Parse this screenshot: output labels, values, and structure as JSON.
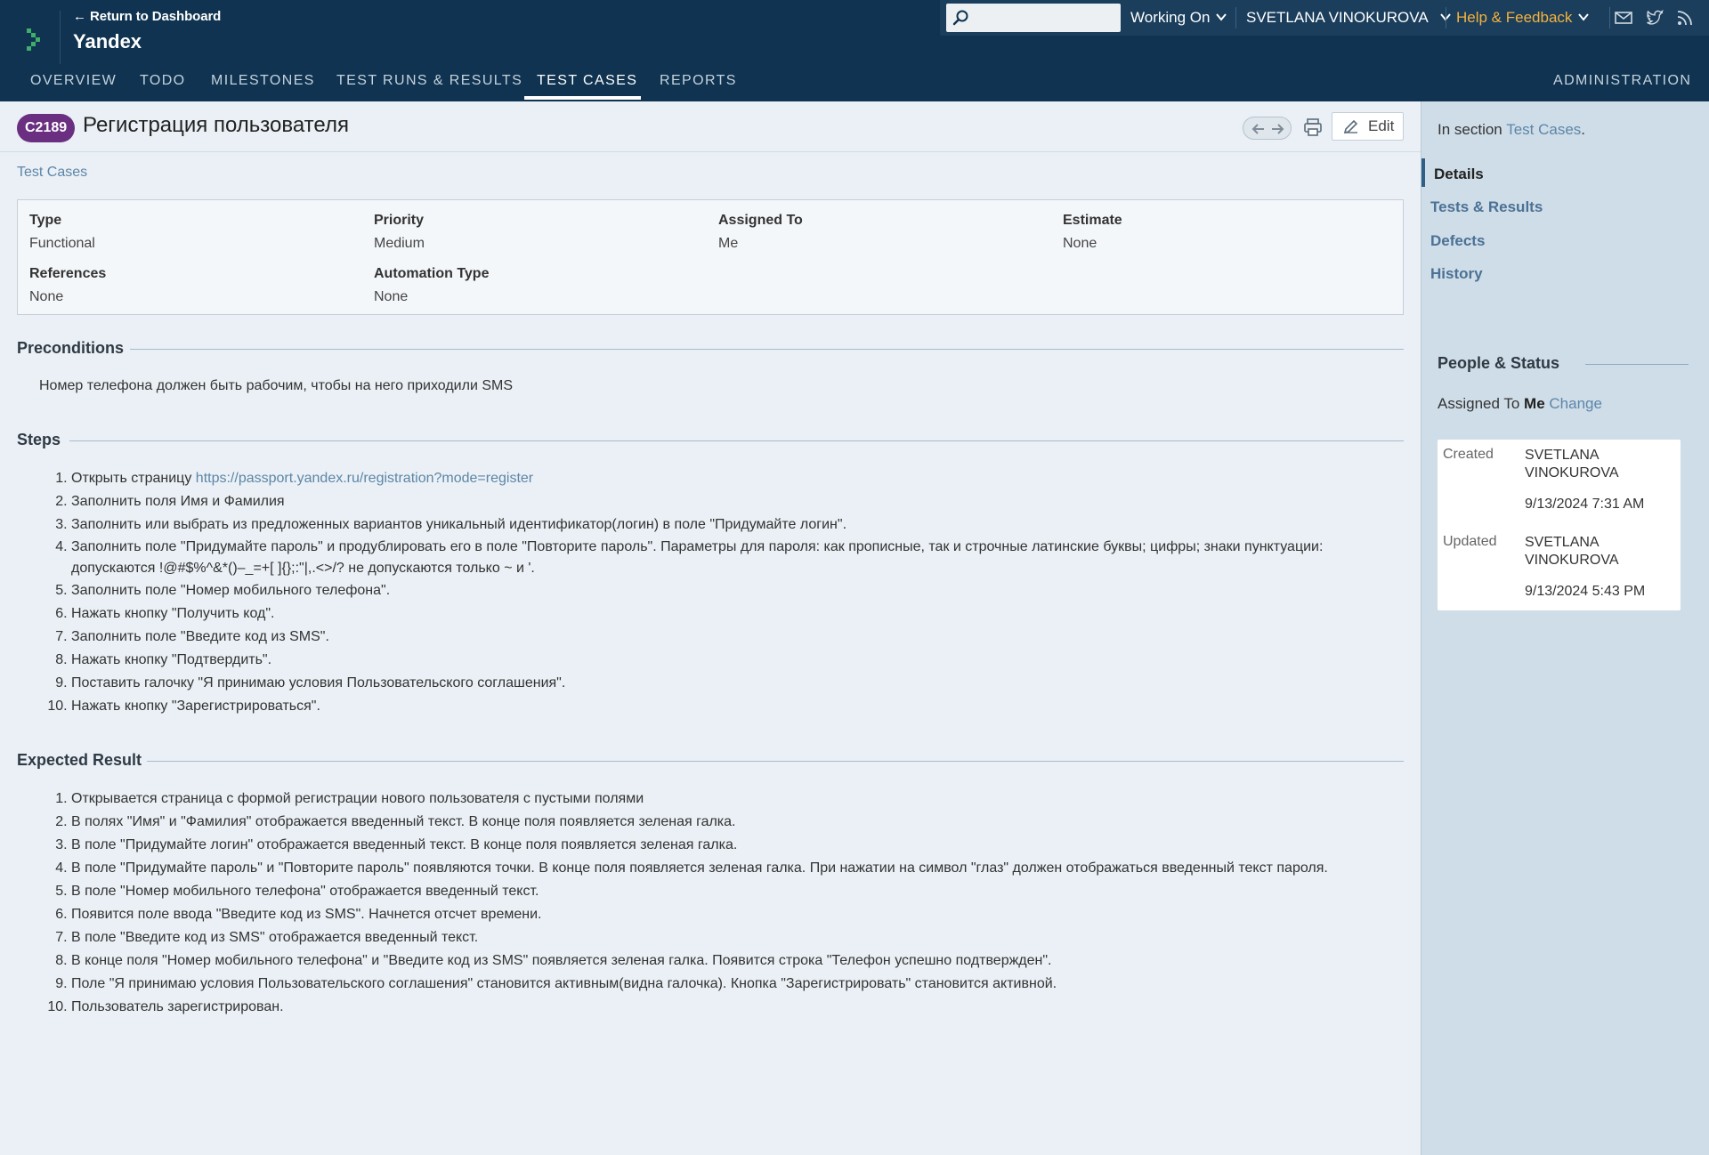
{
  "header": {
    "back_link": "← Return to Dashboard",
    "project_name": "Yandex",
    "search_placeholder": "",
    "working_on": "Working On",
    "user_name": "SVETLANA VINOKUROVA",
    "help": "Help & Feedback",
    "icons": [
      "mail-icon",
      "twitter-icon",
      "rss-icon"
    ]
  },
  "nav": {
    "tabs": [
      "OVERVIEW",
      "TODO",
      "MILESTONES",
      "TEST RUNS & RESULTS",
      "TEST CASES",
      "REPORTS"
    ],
    "active_tab": "TEST CASES",
    "admin": "ADMINISTRATION"
  },
  "case": {
    "id": "C2189",
    "title": "Регистрация пользователя",
    "edit_label": "Edit",
    "breadcrumb": "Test Cases"
  },
  "fields": {
    "type_label": "Type",
    "type_value": "Functional",
    "priority_label": "Priority",
    "priority_value": "Medium",
    "assigned_label": "Assigned To",
    "assigned_value": "Me",
    "estimate_label": "Estimate",
    "estimate_value": "None",
    "references_label": "References",
    "references_value": "None",
    "automation_label": "Automation Type",
    "automation_value": "None"
  },
  "preconditions": {
    "heading": "Preconditions",
    "text": "Номер телефона должен быть рабочим, чтобы на него приходили SMS"
  },
  "steps": {
    "heading": "Steps",
    "step1_prefix": "Открыть страницу ",
    "step1_link": "https://passport.yandex.ru/registration?mode=register",
    "items": [
      "Заполнить поля Имя и Фамилия",
      "Заполнить или выбрать из предложенных вариантов уникальный идентификатор(логин) в поле \"Придумайте логин\".",
      "Заполнить поле \"Придумайте пароль\" и продублировать его в поле \"Повторите пароль\". Параметры для пароля: как прописные, так и строчные латинские буквы; цифры; знаки пунктуации: допускаются !@#$%^&*()–_=+[ ]{};:\"|,.<>/? не допускаются только ~ и '.",
      "Заполнить поле \"Номер мобильного телефона\".",
      "Нажать кнопку \"Получить код\".",
      "Заполнить поле \"Введите код из SMS\".",
      "Нажать кнопку \"Подтвердить\".",
      "Поставить галочку \"Я принимаю условия Пользовательского соглашения\".",
      "Нажать кнопку \"Зарегистрироваться\"."
    ]
  },
  "expected": {
    "heading": "Expected Result",
    "items": [
      "Открывается страница с формой регистрации нового пользователя с пустыми полями",
      "В полях \"Имя\" и \"Фамилия\" отображается введенный текст. В конце поля появляется зеленая галка.",
      "В поле \"Придумайте логин\" отображается введенный текст. В конце поля появляется зеленая галка.",
      "В поле \"Придумайте пароль\" и \"Повторите пароль\" появляются точки. В конце поля появляется зеленая галка. При нажатии на символ \"глаз\" должен отображаться введенный текст пароля.",
      "В поле \"Номер мобильного телефона\" отображается введенный текст.",
      "Появится поле ввода \"Введите код из SMS\". Начнется отсчет времени.",
      "В поле \"Введите код из SMS\" отображается введенный текст.",
      "В конце поля \"Номер мобильного телефона\" и \"Введите код из SMS\" появляется зеленая галка. Появится строка \"Телефон успешно подтвержден\".",
      "Поле \"Я принимаю условия Пользовательского соглашения\" становится активным(видна галочка). Кнопка \"Зарегистрировать\" становится активной.",
      "Пользователь зарегистрирован."
    ]
  },
  "sidebar": {
    "in_section_prefix": "In section ",
    "in_section_link": "Test Cases",
    "in_section_suffix": ".",
    "nav": [
      "Details",
      "Tests & Results",
      "Defects",
      "History"
    ],
    "people_heading": "People & Status",
    "assigned_prefix": "Assigned To ",
    "assigned_value": "Me",
    "change_link": "Change",
    "created_label": "Created",
    "created_by": "SVETLANA VINOKUROVA",
    "created_at": "9/13/2024 7:31 AM",
    "updated_label": "Updated",
    "updated_by": "SVETLANA VINOKUROVA",
    "updated_at": "9/13/2024 5:43 PM"
  },
  "colors": {
    "header_bg": "#0f3350",
    "accent_help": "#f4b23e",
    "badge_bg": "#6a2f80",
    "link": "#5d86a8"
  }
}
